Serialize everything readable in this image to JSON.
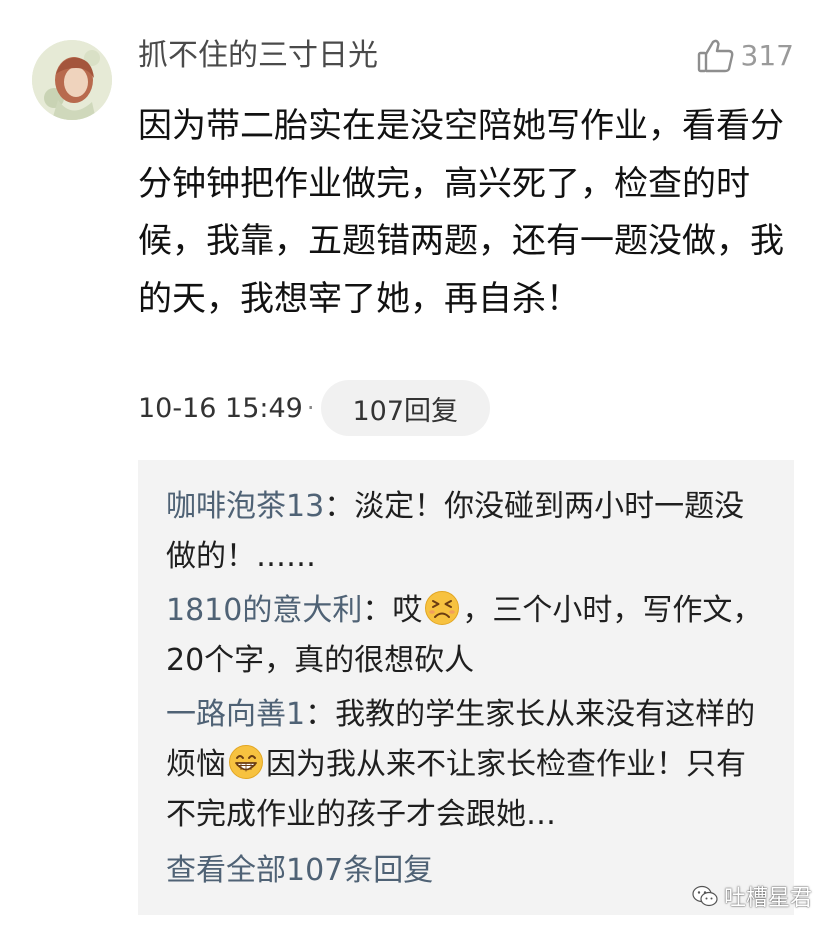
{
  "comment": {
    "username": "抓不住的三寸日光",
    "like_count": "317",
    "text": "因为带二胎实在是没空陪她写作业，看看分分钟钟把作业做完，高兴死了，检查的时候，我靠，五题错两题，还有一题没做，我的天，我想宰了她，再自杀！",
    "timestamp": "10-16 15:49",
    "separator": "·",
    "reply_count_label": "107回复"
  },
  "replies": [
    {
      "author": "咖啡泡茶13",
      "separator": "：",
      "text_before": "淡定！你没碰到两小时一题没做的！……",
      "emoji": "",
      "text_after": ""
    },
    {
      "author": "1810的意大利",
      "separator": "：",
      "text_before": "哎",
      "emoji": "tired-face-emoji",
      "text_after": "，三个小时，写作文，20个字，真的很想砍人"
    },
    {
      "author": "一路向善1",
      "separator": "：",
      "text_before": "我教的学生家长从来没有这样的烦恼",
      "emoji": "grinning-face-emoji",
      "text_after": "因为我从来不让家长检查作业！只有不完成作业的孩子才会跟她…"
    }
  ],
  "view_all_label": "查看全部107条回复",
  "watermark": {
    "text": "吐槽星君",
    "icon": "wechat-logo-icon"
  },
  "colors": {
    "author_link": "#4f6275",
    "reply_bg": "#f3f3f3",
    "pill_bg": "#f1f1f1",
    "meta_gray": "#9a9a9a"
  }
}
